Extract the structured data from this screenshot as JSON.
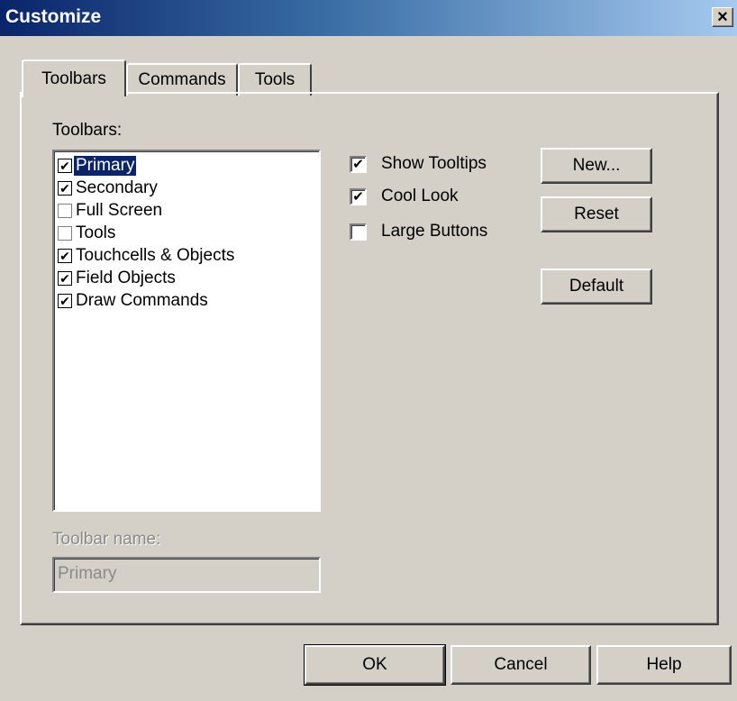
{
  "window": {
    "title": "Customize",
    "close_glyph": "×"
  },
  "tabs": [
    {
      "label": "Toolbars",
      "active": true
    },
    {
      "label": "Commands",
      "active": false
    },
    {
      "label": "Tools",
      "active": false
    }
  ],
  "toolbars_label": "Toolbars:",
  "toolbar_list": [
    {
      "label": "Primary",
      "checked": true,
      "selected": true
    },
    {
      "label": "Secondary",
      "checked": true,
      "selected": false
    },
    {
      "label": "Full Screen",
      "checked": false,
      "selected": false
    },
    {
      "label": "Tools",
      "checked": false,
      "selected": false
    },
    {
      "label": "Touchcells & Objects",
      "checked": true,
      "selected": false
    },
    {
      "label": "Field Objects",
      "checked": true,
      "selected": false
    },
    {
      "label": "Draw Commands",
      "checked": true,
      "selected": false
    }
  ],
  "options": [
    {
      "label": "Show Tooltips",
      "checked": true
    },
    {
      "label": "Cool Look",
      "checked": true
    },
    {
      "label": "Large Buttons",
      "checked": false
    }
  ],
  "side_buttons": {
    "new": "New...",
    "reset": "Reset",
    "default": "Default"
  },
  "toolbar_name": {
    "label": "Toolbar name:",
    "value": "Primary"
  },
  "footer_buttons": {
    "ok": "OK",
    "cancel": "Cancel",
    "help": "Help"
  },
  "check_glyph": "✔"
}
